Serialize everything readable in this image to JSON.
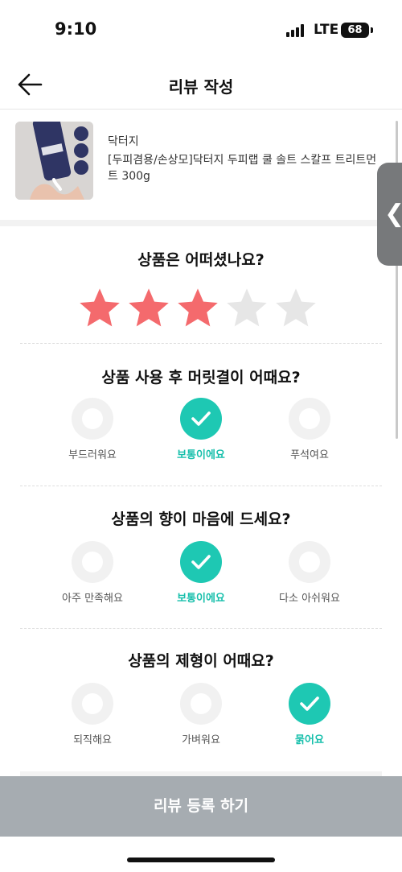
{
  "status": {
    "time": "9:10",
    "network": "LTE",
    "battery": "68"
  },
  "header": {
    "title": "리뷰 작성"
  },
  "product": {
    "brand": "닥터지",
    "name": "[두피겸용/손상모]닥터지 두피랩 쿨 솔트 스칼프 트리트먼트 300g"
  },
  "rating": {
    "question": "상품은 어떠셨나요?",
    "value": 3,
    "max": 5,
    "active_color": "#f46a6d",
    "inactive_color": "#e6e6e6"
  },
  "questions": [
    {
      "question": "상품 사용 후 머릿결이 어때요?",
      "options": [
        "부드러워요",
        "보통이에요",
        "푸석여요"
      ],
      "selected": 1
    },
    {
      "question": "상품의 향이 마음에 드세요?",
      "options": [
        "아주 만족해요",
        "보통이에요",
        "다소 아쉬워요"
      ],
      "selected": 1
    },
    {
      "question": "상품의 제형이 어때요?",
      "options": [
        "되직해요",
        "가벼워요",
        "묽어요"
      ],
      "selected": 2
    }
  ],
  "submit": {
    "label": "리뷰 등록 하기"
  },
  "accent_color": "#1ec8b3"
}
